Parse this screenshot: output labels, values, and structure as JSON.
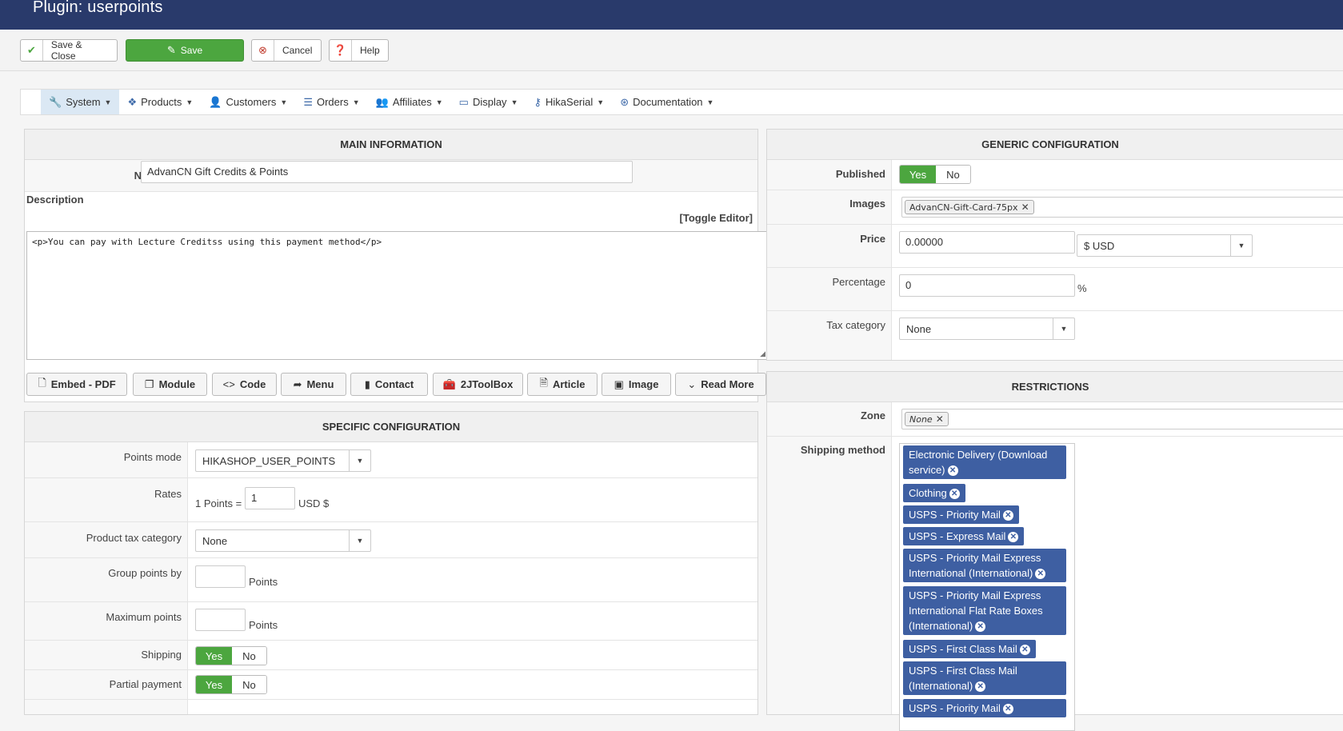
{
  "header": {
    "title": "Plugin: userpoints"
  },
  "toolbar": {
    "save_close": "Save & Close",
    "save": "Save",
    "cancel": "Cancel",
    "help": "Help"
  },
  "menu": [
    {
      "label": "System",
      "icon": "wrench-icon"
    },
    {
      "label": "Products",
      "icon": "cubes-icon"
    },
    {
      "label": "Customers",
      "icon": "user-icon"
    },
    {
      "label": "Orders",
      "icon": "list-icon"
    },
    {
      "label": "Affiliates",
      "icon": "users-icon"
    },
    {
      "label": "Display",
      "icon": "monitor-icon"
    },
    {
      "label": "HikaSerial",
      "icon": "key-icon"
    },
    {
      "label": "Documentation",
      "icon": "lifebuoy-icon"
    }
  ],
  "main_info": {
    "title": "MAIN INFORMATION",
    "name_label": "Name",
    "name_value": "AdvanCN Gift Credits & Points",
    "description_label": "Description",
    "toggle_editor": "[Toggle Editor]",
    "editor_content": "<p>You can pay with Lecture Creditss using this payment method</p>",
    "editor_buttons": [
      "Embed - PDF",
      "Module",
      "Code",
      "Menu",
      "Contact",
      "2JToolBox",
      "Article",
      "Image",
      "Read More"
    ]
  },
  "specific": {
    "title": "SPECIFIC CONFIGURATION",
    "points_mode_label": "Points mode",
    "points_mode_value": "HIKASHOP_USER_POINTS",
    "rates_label": "Rates",
    "rates_prefix": "1 Points =",
    "rates_value": "1",
    "rates_suffix": "USD $",
    "product_tax_label": "Product tax category",
    "product_tax_value": "None",
    "group_points_label": "Group points by",
    "group_points_suffix": "Points",
    "max_points_label": "Maximum points",
    "max_points_suffix": "Points",
    "shipping_label": "Shipping",
    "partial_label": "Partial payment",
    "yes": "Yes",
    "no": "No"
  },
  "generic": {
    "title": "GENERIC CONFIGURATION",
    "published_label": "Published",
    "yes": "Yes",
    "no": "No",
    "images_label": "Images",
    "image_chip": "AdvanCN-Gift-Card-75px",
    "price_label": "Price",
    "price_value": "0.00000",
    "currency_value": "$ USD",
    "percentage_label": "Percentage",
    "percentage_value": "0",
    "percent_sign": "%",
    "tax_label": "Tax category",
    "tax_value": "None"
  },
  "restrictions": {
    "title": "RESTRICTIONS",
    "zone_label": "Zone",
    "zone_chip": "None",
    "shipping_label": "Shipping method",
    "shipping_tags": [
      "Electronic Delivery (Download service)",
      "Clothing",
      "USPS - Priority Mail",
      "USPS - Express Mail",
      "USPS - Priority Mail Express International (International)",
      "USPS - Priority Mail Express International Flat Rate Boxes (International)",
      "USPS - First Class Mail",
      "USPS - First Class Mail (International)",
      "USPS - Priority Mail"
    ]
  }
}
